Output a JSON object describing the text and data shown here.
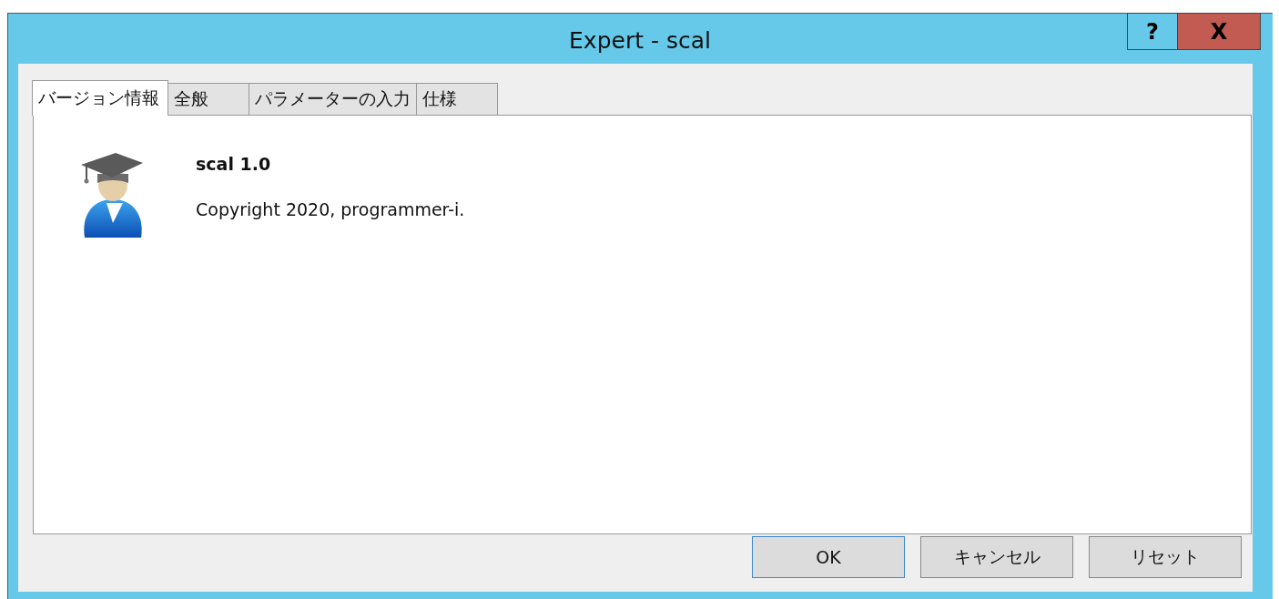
{
  "window": {
    "title": "Expert - scal",
    "help": "?",
    "close": "X"
  },
  "tabs": [
    {
      "label": "バージョン情報",
      "selected": true
    },
    {
      "label": "全般",
      "selected": false
    },
    {
      "label": "パラメーターの入力",
      "selected": false
    },
    {
      "label": "仕様",
      "selected": false
    }
  ],
  "about": {
    "name": "scal 1.0",
    "copyright": "Copyright 2020, programmer-i."
  },
  "buttons": [
    {
      "label": "OK",
      "default": true
    },
    {
      "label": "キャンセル",
      "default": false
    },
    {
      "label": "リセット",
      "default": false
    }
  ]
}
